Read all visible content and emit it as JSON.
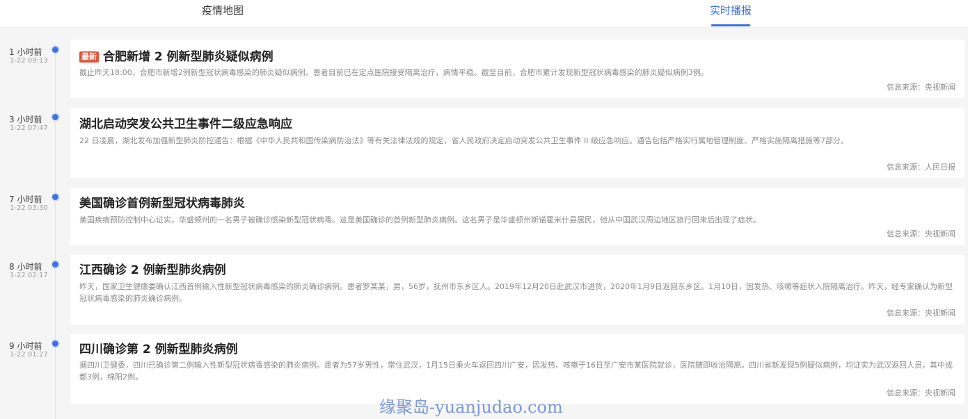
{
  "tabs": [
    {
      "label": "疫情地图",
      "active": false
    },
    {
      "label": "实时播报",
      "active": true
    }
  ],
  "accent_color": "#3a6ed8",
  "badge_color": "#e3543c",
  "news": [
    {
      "time_relative": "1 小时前",
      "time_absolute": "1-22 09:13",
      "badge": "最新",
      "title": "合肥新增 2 例新型肺炎疑似病例",
      "desc": "截止昨天18:00，合肥市新增2例新型冠状病毒感染的肺炎疑似病例。患者目前已在定点医院接受隔离治疗，病情平稳。截至目前，合肥市累计发现新型冠状病毒感染的肺炎疑似病例3例。",
      "source": "信息来源：央视新闻"
    },
    {
      "time_relative": "3 小时前",
      "time_absolute": "1-22 07:47",
      "title": "湖北启动突发公共卫生事件二级应急响应",
      "desc": "22 日凌晨，湖北发布加强新型肺炎防控通告：根据《中华人民共和国传染病防治法》等有关法律法规的规定，省人民政府决定启动突发公共卫生事件 II 级应急响应。通告包括严格实行属地管理制度、严格实施隔离措施等7部分。",
      "source": "信息来源：人民日报"
    },
    {
      "time_relative": "7 小时前",
      "time_absolute": "1-22 03:30",
      "title": "美国确诊首例新型冠状病毒肺炎",
      "desc": "美国疾病预防控制中心证实，华盛顿州的一名男子被确诊感染新型冠状病毒。这是美国确诊的首例新型肺炎病例。这名男子是华盛顿州斯诺霍米什县居民，他从中国武汉周边地区旅行回来后出现了症状。",
      "source": "信息来源：央视新闻"
    },
    {
      "time_relative": "8 小时前",
      "time_absolute": "1-22 02:17",
      "title": "江西确诊 2 例新型肺炎病例",
      "desc": "昨天，国家卫生健康委确认江西首例输入性新型冠状病毒感染的肺炎确诊病例。患者罗某某，男，56岁，抚州市东乡区人。2019年12月20日赴武汉市进货，2020年1月9日返回东乡区。1月10日，因发热、咳嗽等症状入院隔离治疗。昨天，经专家确认为新型冠状病毒感染的肺炎确诊病例。",
      "source": "信息来源：央视新闻"
    },
    {
      "time_relative": "9 小时前",
      "time_absolute": "1-22 01:27",
      "title": "四川确诊第 2 例新型肺炎病例",
      "desc": "据四川卫健委，四川已确诊第二例输入性新型冠状病毒感染的肺炎病例。患者为57岁男性，常住武汉，1月15日乘火车返回四川广安，因发热、咳嗽于16日至广安市某医院就诊，医院随即收治隔离。四川省新发现5例疑似病例，均证实为武汉返回人员，其中成都3例，绵阳2例。",
      "source": "信息来源：央视新闻"
    }
  ],
  "watermark": "缘聚岛-yuanjudao.com"
}
